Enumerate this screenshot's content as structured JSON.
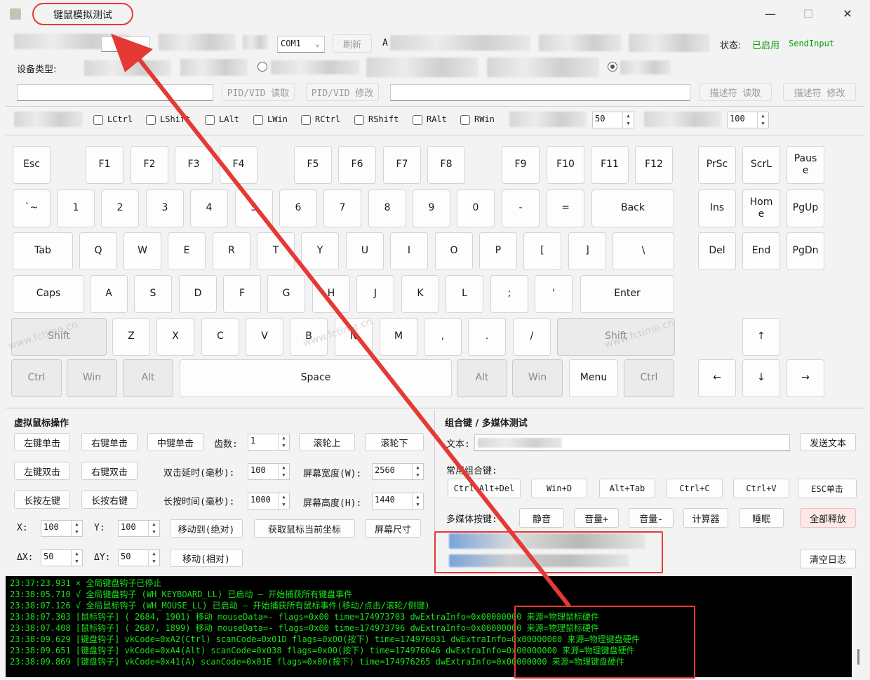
{
  "window": {
    "title": "键鼠模拟测试",
    "minimize": "—",
    "maximize": "☐",
    "close": "✕"
  },
  "toolbar": {
    "com_port": "COM1",
    "refresh": "刷新",
    "prefix_a": "A",
    "status_label": "状态:",
    "status_value": "已启用",
    "status_mode": "SendInput",
    "device_type_label": "设备类型:",
    "pidvid_read": "PID/VID 读取",
    "pidvid_write": "PID/VID 修改",
    "desc_read": "描述符 读取",
    "desc_write": "描述符 修改"
  },
  "modifiers": {
    "items": [
      "LCtrl",
      "LShift",
      "LAlt",
      "LWin",
      "RCtrl",
      "RShift",
      "RAlt",
      "RWin"
    ],
    "spin1": "50",
    "spin2": "100"
  },
  "keyboard": {
    "row1": [
      "Esc",
      "F1",
      "F2",
      "F3",
      "F4",
      "F5",
      "F6",
      "F7",
      "F8",
      "F9",
      "F10",
      "F11",
      "F12",
      "PrSc",
      "ScrL",
      "Paus\ne"
    ],
    "row2": [
      "`~",
      "1",
      "2",
      "3",
      "4",
      "5",
      "6",
      "7",
      "8",
      "9",
      "0",
      "-",
      "=",
      "Back",
      "Ins",
      "Hom\ne",
      "PgUp"
    ],
    "row3": [
      "Tab",
      "Q",
      "W",
      "E",
      "R",
      "T",
      "Y",
      "U",
      "I",
      "O",
      "P",
      "[",
      "]",
      "\\",
      "Del",
      "End",
      "PgDn"
    ],
    "row4": [
      "Caps",
      "A",
      "S",
      "D",
      "F",
      "G",
      "H",
      "J",
      "K",
      "L",
      ";",
      "'",
      "Enter"
    ],
    "row5": [
      "Shift",
      "Z",
      "X",
      "C",
      "V",
      "B",
      "N",
      "M",
      ",",
      ".",
      "/",
      "Shift",
      "↑"
    ],
    "row6": [
      "Ctrl",
      "Win",
      "Alt",
      "Space",
      "Alt",
      "Win",
      "Menu",
      "Ctrl",
      "←",
      "↓",
      "→"
    ]
  },
  "mouse": {
    "title": "虚拟鼠标操作",
    "left_click": "左键单击",
    "right_click": "右键单击",
    "middle_click": "中键单击",
    "wheel_count_label": "齿数:",
    "wheel_count": "1",
    "wheel_up": "滚轮上",
    "wheel_down": "滚轮下",
    "left_double": "左键双击",
    "right_double": "右键双击",
    "double_delay_label": "双击延时(毫秒):",
    "double_delay": "100",
    "screen_width_label": "屏幕宽度(W):",
    "screen_width": "2560",
    "long_left": "长按左键",
    "long_right": "长按右键",
    "long_time_label": "长按时间(毫秒):",
    "long_time": "1000",
    "screen_height_label": "屏幕高度(H):",
    "screen_height": "1440",
    "x_label": "X:",
    "x_val": "100",
    "y_label": "Y:",
    "y_val": "100",
    "move_abs": "移动到(绝对)",
    "get_pos": "获取鼠标当前坐标",
    "screen_size": "屏幕尺寸",
    "dx_label": "ΔX:",
    "dx_val": "50",
    "dy_label": "ΔY:",
    "dy_val": "50",
    "move_rel": "移动(相对)"
  },
  "combo": {
    "title": "组合键 / 多媒体测试",
    "text_label": "文本:",
    "send_text": "发送文本",
    "common_label": "常用组合键:",
    "combos": [
      "Ctrl+Alt+Del",
      "Win+D",
      "Alt+Tab",
      "Ctrl+C",
      "Ctrl+V",
      "ESC单击"
    ],
    "media_label": "多媒体按键:",
    "media": [
      "静音",
      "音量+",
      "音量-",
      "计算器",
      "睡眠"
    ],
    "release_all": "全部释放",
    "clear_log": "清空日志"
  },
  "log": [
    "23:37:23.931  × 全局键盘钩子已停止",
    "23:38:05.710  √ 全局键盘钩子 (WH_KEYBOARD_LL) 已启动 — 开始捕获所有键盘事件",
    "23:38:07.126  √ 全局鼠标钩子 (WH_MOUSE_LL) 已启动 — 开始捕获所有鼠标事件(移动/点击/滚轮/侧键)",
    "23:38:07.303  [鼠标钩子] ( 2684, 1901) 移动 mouseData=- flags=0x00 time=174973703 dwExtraInfo=0x00000000 来源=物理鼠标硬件",
    "23:38:07.408  [鼠标钩子] ( 2687, 1899) 移动 mouseData=- flags=0x00 time=174973796 dwExtraInfo=0x00000000 来源=物理鼠标硬件",
    "23:38:09.629  [键盘钩子] vkCode=0xA2(Ctrl) scanCode=0x01D flags=0x00(按下) time=174976031 dwExtraInfo=0x00000000 来源=物理键盘硬件",
    "23:38:09.651  [键盘钩子] vkCode=0xA4(Alt) scanCode=0x038 flags=0x00(按下) time=174976046 dwExtraInfo=0x00000000 来源=物理键盘硬件",
    "23:38:09.869  [键盘钩子] vkCode=0x41(A) scanCode=0x01E flags=0x00(按下) time=174976265 dwExtraInfo=0x00000000 来源=物理键盘硬件"
  ],
  "watermark": "www.fctime.cn",
  "colors": {
    "status_green": "#0a9a0a",
    "log_green": "#19e019",
    "annotation_red": "#e53935"
  }
}
